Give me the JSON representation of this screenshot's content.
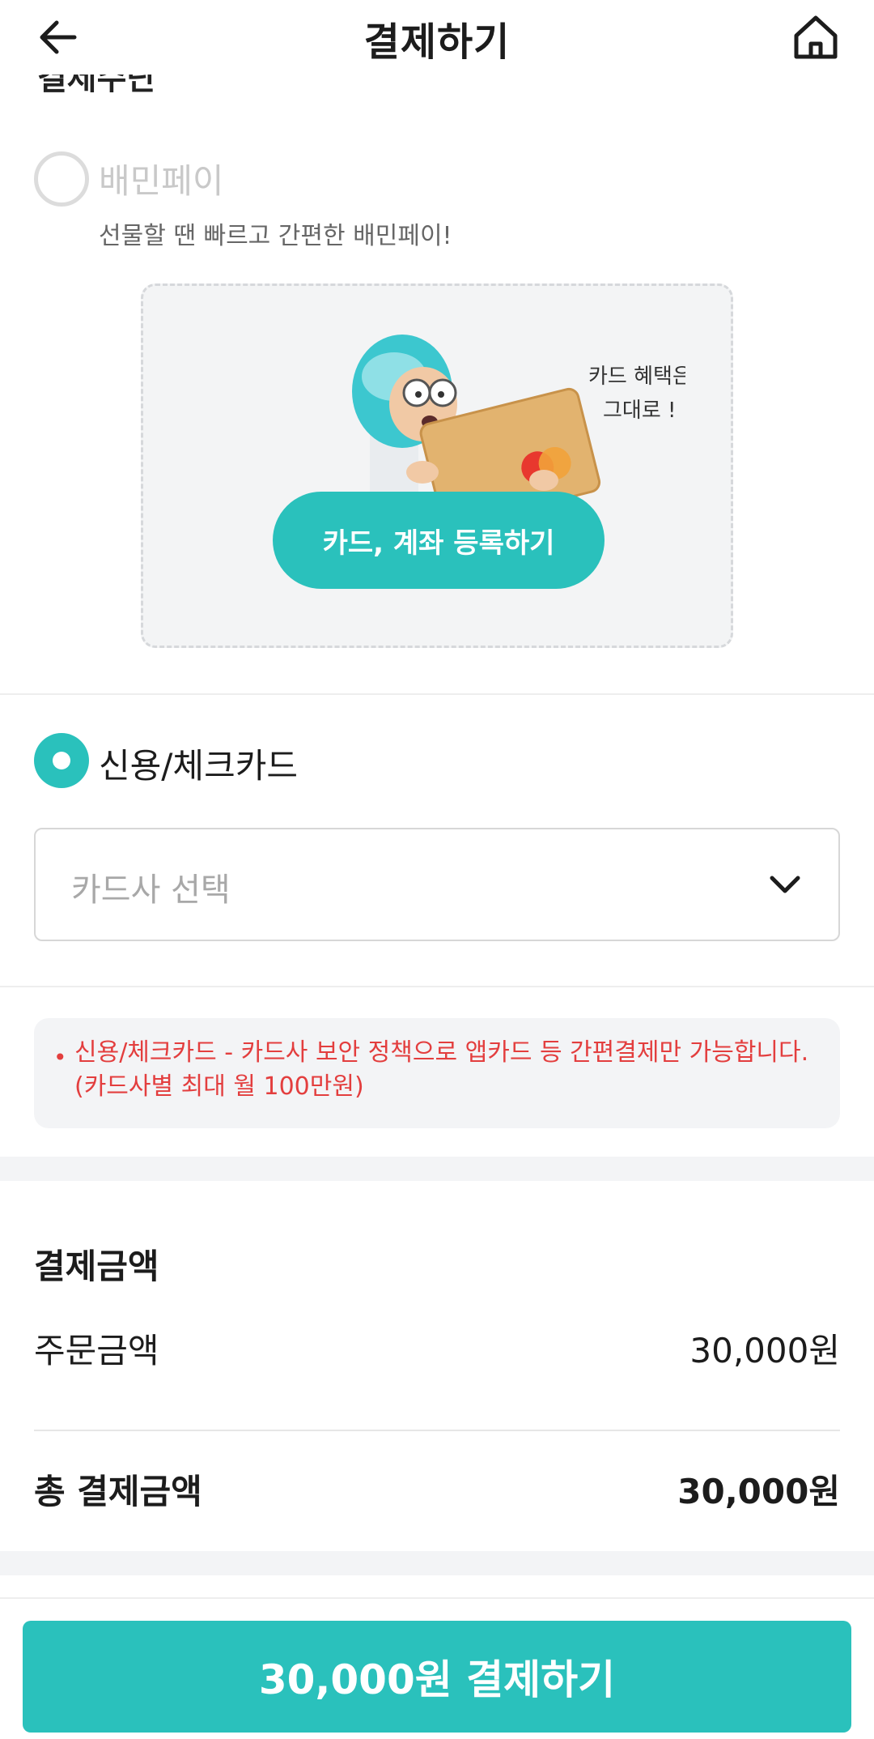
{
  "header": {
    "title": "결제하기",
    "back_icon": "back-arrow-icon",
    "home_icon": "home-icon"
  },
  "payment_methods": {
    "section_cut_label": "결제수단",
    "baemin_pay": {
      "label": "배민페이",
      "description": "선물할 땐 빠르고 간편한 배민페이!",
      "selected": false,
      "promo_caption_line1": "카드 혜택은",
      "promo_caption_line2": "그대로 !",
      "register_button": "카드, 계좌 등록하기"
    },
    "credit_card": {
      "label": "신용/체크카드",
      "selected": true,
      "select_placeholder": "카드사 선택",
      "notice_bullet": "•",
      "notice": "신용/체크카드 - 카드사 보안 정책으로 앱카드 등 간편결제만 가능합니다. (카드사별 최대 월 100만원)"
    }
  },
  "amount": {
    "title": "결제금액",
    "order_label": "주문금액",
    "order_value": "30,000원",
    "total_label": "총 결제금액",
    "total_value": "30,000원"
  },
  "pay_button": "30,000원 결제하기",
  "colors": {
    "accent": "#2ac1bc",
    "notice_red": "#e33e3e",
    "band_gray": "#f3f4f6"
  }
}
